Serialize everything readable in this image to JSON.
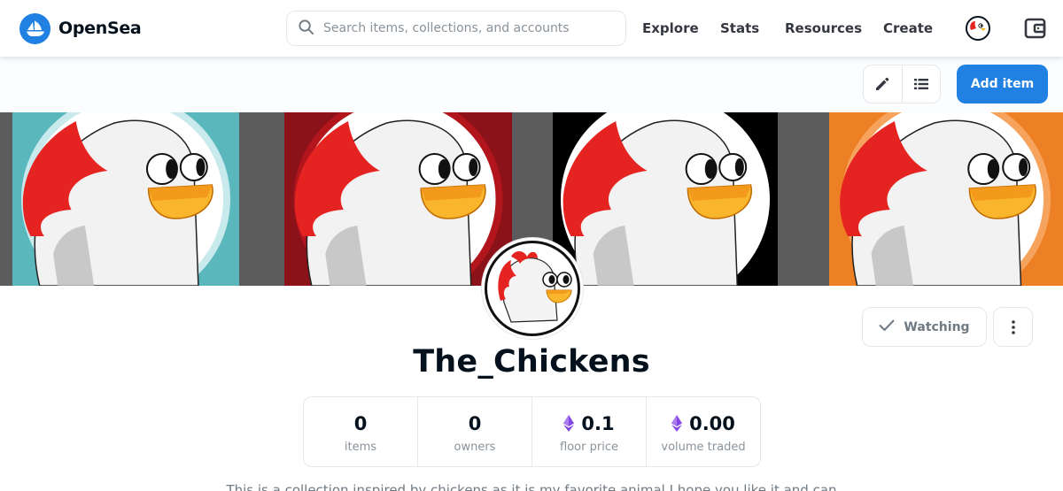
{
  "brand": {
    "name": "OpenSea",
    "logo_icon": "opensea-ship-logo",
    "accent": "#2081e2"
  },
  "search": {
    "placeholder": "Search items, collections, and accounts",
    "value": "",
    "icon": "search-icon"
  },
  "nav": {
    "explore": "Explore",
    "stats": "Stats",
    "resources": "Resources",
    "create": "Create"
  },
  "header_icons": {
    "profile": "chicken-avatar-icon",
    "wallet": "wallet-icon"
  },
  "toolbar": {
    "edit_icon": "pencil-icon",
    "list_icon": "list-icon",
    "add_item": "Add item"
  },
  "banner": {
    "panels": [
      {
        "bg": "#5ab8bd",
        "ring": "#c9eaec"
      },
      {
        "bg": "#8b1219",
        "ring": "#b3151d"
      },
      {
        "bg": "#000000",
        "ring": "#ffffff"
      },
      {
        "bg": "#ed7f24",
        "ring": "#f6a45d"
      }
    ]
  },
  "collection": {
    "name": "The_Chickens",
    "watching_label": "Watching",
    "watch_icon": "checkmark-icon",
    "more_icon": "more-vertical-icon",
    "stats": [
      {
        "value": "0",
        "label": "items",
        "eth": false
      },
      {
        "value": "0",
        "label": "owners",
        "eth": false
      },
      {
        "value": "0.1",
        "label": "floor price",
        "eth": true
      },
      {
        "value": "0.00",
        "label": "volume traded",
        "eth": true
      }
    ],
    "description": "This is a collection inspired by chickens as it is my favorite animal I hope you like it and can"
  }
}
